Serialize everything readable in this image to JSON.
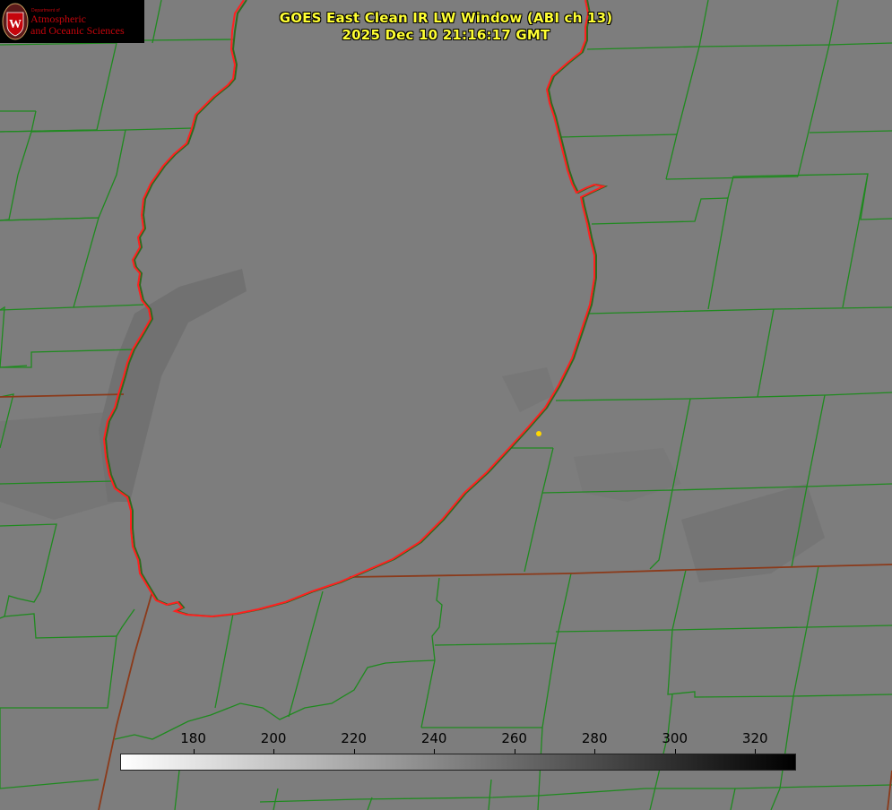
{
  "logo": {
    "department": "Department of",
    "line1": "Atmospheric",
    "line2": "and Oceanic Sciences"
  },
  "title": {
    "line1": "GOES East Clean IR LW Window (ABI ch 13)",
    "line2": "2025 Dec 10 21:16:17 GMT"
  },
  "colorbar": {
    "min": 162,
    "max": 330,
    "ticks": [
      "180",
      "200",
      "220",
      "240",
      "260",
      "280",
      "300",
      "320"
    ]
  },
  "colors": {
    "title": "#ffff33",
    "county_lines": "#1f8a1f",
    "lake_outline": "#ff2020",
    "marker": "#ffd700"
  }
}
